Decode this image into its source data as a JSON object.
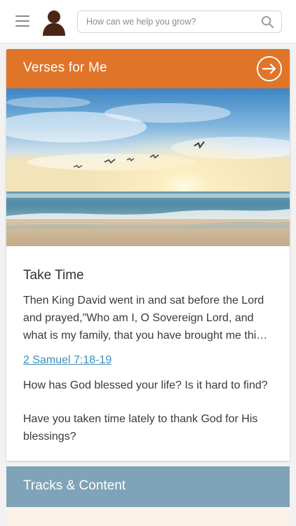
{
  "header": {
    "search_placeholder": "How can we help you grow?"
  },
  "verses_card": {
    "title": "Verses for Me",
    "verse_title": "Take Time",
    "verse_text": "Then King David went in and sat before the Lord and prayed,\"Who am I, O Sovereign Lord, and what is my family, that you have brought me thi…",
    "reference": "2 Samuel 7:18-19",
    "question_1": "How has God blessed your life? Is it hard to find?",
    "question_2": "Have you taken time lately to thank God for His blessings?",
    "header_color": "#e07428",
    "link_color": "#3a8fc2"
  },
  "tracks": {
    "title": "Tracks & Content",
    "header_color": "#7fa3b8"
  },
  "icons": {
    "menu": "hamburger-menu-icon",
    "profile": "user-avatar-icon",
    "search": "search-icon",
    "next": "arrow-right-circle-icon"
  }
}
